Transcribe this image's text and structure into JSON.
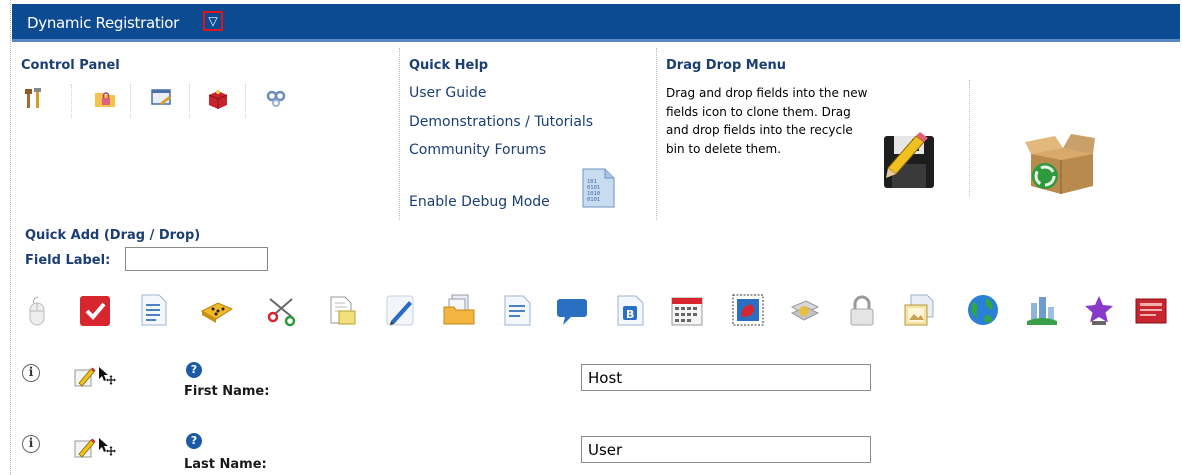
{
  "titlebar": {
    "title": "Dynamic Registratior",
    "menu_glyph": "▽"
  },
  "control_panel": {
    "heading": "Control Panel",
    "icons": [
      "tools-icon",
      "folder-lock-icon",
      "window-edit-icon",
      "gift-box-icon",
      "gears-icon"
    ]
  },
  "quick_help": {
    "heading": "Quick Help",
    "links": [
      "User Guide",
      "Demonstrations / Tutorials",
      "Community Forums"
    ],
    "debug_link": "Enable Debug Mode",
    "debug_icon": "binary-document-icon"
  },
  "drag_drop": {
    "heading": "Drag Drop Menu",
    "text": "Drag and drop fields into the new fields icon to clone them. Drag and drop fields into the recycle bin to delete them.",
    "clone_icon": "floppy-pencil-icon",
    "recycle_icon": "recycle-bin-icon"
  },
  "quick_add": {
    "heading": "Quick Add (Drag / Drop)",
    "field_label": "Field Label:",
    "field_value": "",
    "toolbox_icons": [
      "mouse-icon",
      "checkbox-icon",
      "list-document-icon",
      "dice-icon",
      "scissors-icon",
      "document-copy-icon",
      "pen-icon",
      "folder-documents-icon",
      "text-document-icon",
      "speech-bubble-icon",
      "bold-document-icon",
      "calendar-icon",
      "stamp-icon",
      "layers-icon",
      "padlock-icon",
      "image-document-icon",
      "globe-icon",
      "city-icon",
      "star-icon",
      "banner-icon"
    ]
  },
  "fields": [
    {
      "label": "First Name:",
      "value": "Host",
      "info_glyph": "i",
      "help_glyph": "?"
    },
    {
      "label": "Last Name:",
      "value": "User",
      "info_glyph": "i",
      "help_glyph": "?"
    }
  ],
  "colors": {
    "header_bg": "#0c4a92",
    "link": "#1b3f73",
    "highlight": "#e0141b"
  }
}
